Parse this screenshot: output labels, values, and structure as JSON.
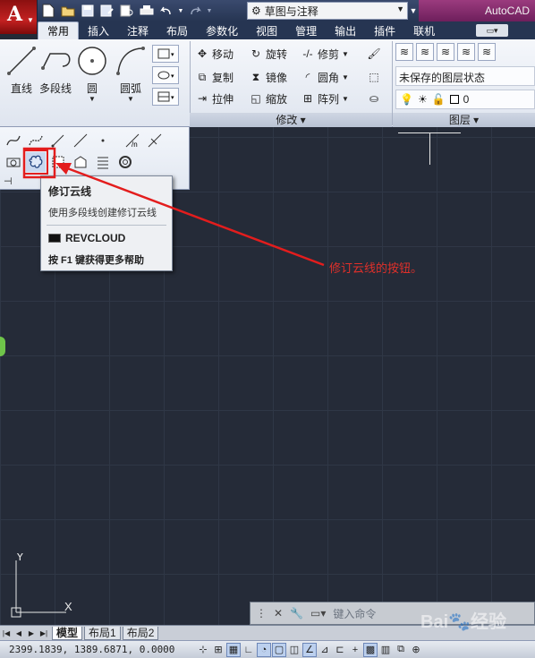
{
  "title_bar": {
    "app_letter": "A",
    "workspace": "草图与注释",
    "app_name": "AutoCAD",
    "qat_icons": [
      "new-icon",
      "open-icon",
      "save-icon",
      "save-as-icon",
      "plot-preview-icon",
      "print-icon",
      "undo-icon",
      "redo-icon"
    ]
  },
  "tabs": [
    {
      "label": "常用",
      "active": true
    },
    {
      "label": "插入",
      "active": false
    },
    {
      "label": "注释",
      "active": false
    },
    {
      "label": "布局",
      "active": false
    },
    {
      "label": "参数化",
      "active": false
    },
    {
      "label": "视图",
      "active": false
    },
    {
      "label": "管理",
      "active": false
    },
    {
      "label": "输出",
      "active": false
    },
    {
      "label": "插件",
      "active": false
    },
    {
      "label": "联机",
      "active": false
    }
  ],
  "draw_panel": {
    "big_buttons": [
      {
        "label": "直线",
        "icon": "line-icon"
      },
      {
        "label": "多段线",
        "icon": "polyline-icon"
      },
      {
        "label": "圆",
        "icon": "circle-icon"
      },
      {
        "label": "圆弧",
        "icon": "arc-icon"
      }
    ]
  },
  "modify_panel": {
    "title": "修改",
    "buttons": [
      {
        "label": "移动",
        "icon": "move-icon"
      },
      {
        "label": "旋转",
        "icon": "rotate-icon"
      },
      {
        "label": "修剪",
        "icon": "trim-icon"
      },
      {
        "label": "复制",
        "icon": "copy-icon"
      },
      {
        "label": "镜像",
        "icon": "mirror-icon"
      },
      {
        "label": "圆角",
        "icon": "fillet-icon"
      },
      {
        "label": "拉伸",
        "icon": "stretch-icon"
      },
      {
        "label": "缩放",
        "icon": "scale-icon"
      },
      {
        "label": "阵列",
        "icon": "array-icon"
      }
    ]
  },
  "layers_panel": {
    "title": "图层",
    "layer_state": "未保存的图层状态",
    "current_layer": "0"
  },
  "tooltip": {
    "title": "修订云线",
    "description": "使用多段线创建修订云线",
    "command": "REVCLOUD",
    "help": "按 F1 键获得更多帮助"
  },
  "annotation": "修订云线的按钮。",
  "command_line": {
    "placeholder": "键入命令"
  },
  "layout_tabs": [
    {
      "label": "模型",
      "active": true
    },
    {
      "label": "布局1",
      "active": false
    },
    {
      "label": "布局2",
      "active": false
    }
  ],
  "status_bar": {
    "coordinates": "2399.1839, 1389.6871, 0.0000"
  },
  "colors": {
    "highlight_box": "#e31d1d",
    "annotation_text": "#e0302a",
    "canvas_bg": "#252b38"
  }
}
